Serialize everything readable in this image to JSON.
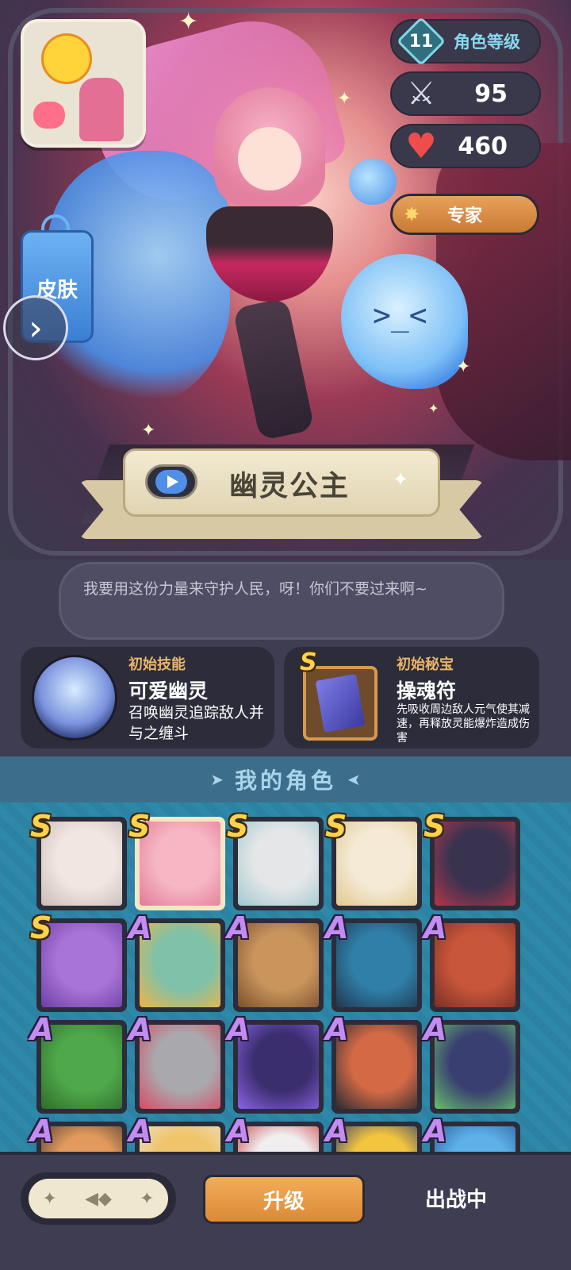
{
  "hero": {
    "character_name": "幽灵公主",
    "level": "11",
    "level_label": "角色等级",
    "attack": "95",
    "health": "460",
    "difficulty_label": "专家",
    "skin_label": "皮肤",
    "quote": "我要用这份力量来守护人民，呀！你们不要过来啊~"
  },
  "skills": {
    "initial_skill": {
      "title": "初始技能",
      "name": "可爱幽灵",
      "description": "召唤幽灵追踪敌人并与之缠斗"
    },
    "initial_treasure": {
      "title": "初始秘宝",
      "rank": "S",
      "name": "操魂符",
      "description": "先吸收周边敌人元气使其减速，再释放灵能爆炸造成伤害"
    }
  },
  "roster": {
    "title": "我的角色",
    "rows": [
      [
        {
          "rank": "S",
          "color": "#f1e6e2",
          "accent": "#c9bcb8"
        },
        {
          "rank": "S",
          "color": "#f6b6c3",
          "accent": "#e27a96",
          "selected": true
        },
        {
          "rank": "S",
          "color": "#e4e6e7",
          "accent": "#9fc9cf"
        },
        {
          "rank": "S",
          "color": "#f4ead6",
          "accent": "#e2c78f"
        },
        {
          "rank": "S",
          "color": "#3a3350",
          "accent": "#b43649"
        }
      ],
      [
        {
          "rank": "S",
          "color": "#a874d6",
          "accent": "#6c3fa4"
        },
        {
          "rank": "A",
          "color": "#7fc1a9",
          "accent": "#f2b441"
        },
        {
          "rank": "A",
          "color": "#c9955d",
          "accent": "#7a4f2c"
        },
        {
          "rank": "A",
          "color": "#2f7fa8",
          "accent": "#20384e"
        },
        {
          "rank": "A",
          "color": "#c8563a",
          "accent": "#7c2f25"
        }
      ],
      [
        {
          "rank": "A",
          "color": "#4fa84a",
          "accent": "#2f6b2b"
        },
        {
          "rank": "A",
          "color": "#a9a9ad",
          "accent": "#d94a63"
        },
        {
          "rank": "A",
          "color": "#3b2e6e",
          "accent": "#8d63e6"
        },
        {
          "rank": "A",
          "color": "#d46a45",
          "accent": "#2a2a30"
        },
        {
          "rank": "A",
          "color": "#3a3f72",
          "accent": "#67c06a"
        }
      ],
      [
        {
          "rank": "A",
          "color": "#e29a5c",
          "accent": "#4a3a30"
        },
        {
          "rank": "A",
          "color": "#f0c46a",
          "accent": "#e8e2cc"
        },
        {
          "rank": "A",
          "color": "#f1eef0",
          "accent": "#c63d3d"
        },
        {
          "rank": "A",
          "color": "#f3c53f",
          "accent": "#283a6e"
        },
        {
          "rank": "A",
          "color": "#5db0e8",
          "accent": "#2a5b96"
        }
      ]
    ]
  },
  "bottom": {
    "upgrade_label": "升级",
    "status_label": "出战中"
  },
  "colors": {
    "accent_orange": "#e8a15a",
    "rank_s": "#ffd24a",
    "rank_a": "#c38cf2",
    "section_bg": "#3c6e8c"
  },
  "icons": [
    "level-badge-icon",
    "sword-icon",
    "heart-icon",
    "sparkle-icon",
    "play-icon",
    "chevron-right-icon",
    "ghost-skill-icon",
    "talisman-icon"
  ]
}
